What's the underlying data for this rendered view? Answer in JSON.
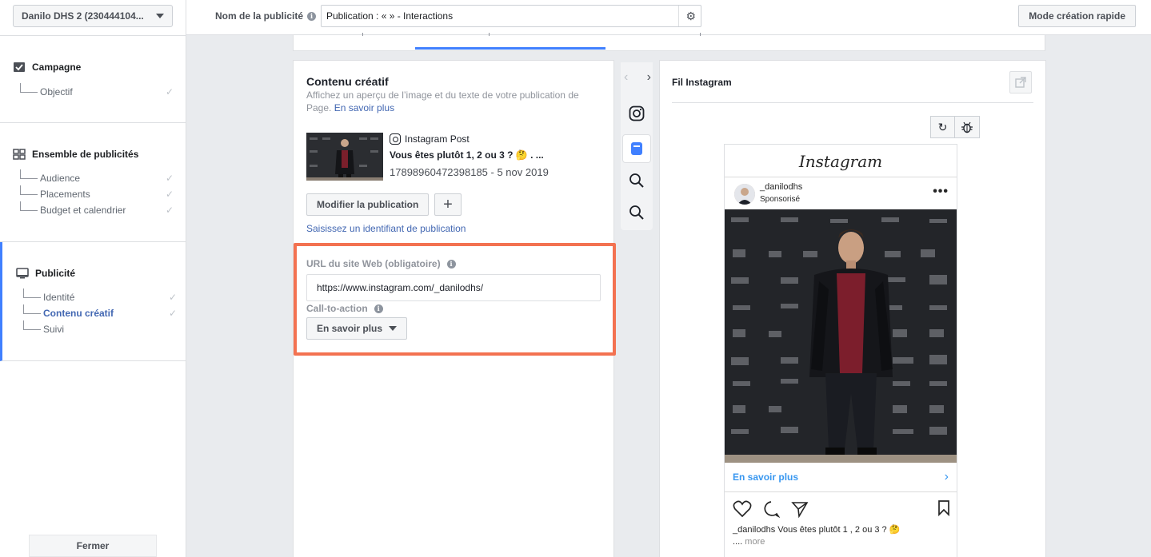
{
  "sidebar": {
    "account": "Danilo DHS 2 (230444104...",
    "campaign": {
      "title": "Campagne",
      "items": [
        {
          "label": "Objectif",
          "done": true
        }
      ]
    },
    "adset": {
      "title": "Ensemble de publicités",
      "items": [
        {
          "label": "Audience",
          "done": true
        },
        {
          "label": "Placements",
          "done": true
        },
        {
          "label": "Budget et calendrier",
          "done": true
        }
      ]
    },
    "ad": {
      "title": "Publicité",
      "items": [
        {
          "label": "Identité",
          "done": true
        },
        {
          "label": "Contenu créatif",
          "done": true,
          "current": true
        },
        {
          "label": "Suivi",
          "done": false
        }
      ]
    },
    "close_label": "Fermer"
  },
  "topbar": {
    "name_label": "Nom de la publicité",
    "name_value": "Publication : «  » - Interactions",
    "quick_mode_label": "Mode création rapide"
  },
  "creative": {
    "title": "Contenu créatif",
    "description": "Affichez un aperçu de l’image et du texte de votre publication de Page.",
    "learn_more": "En savoir plus",
    "post_type": "Instagram Post",
    "post_title": "Vous êtes plutôt 1, 2 ou 3 ? 🤔  . ...",
    "post_meta": "17898960472398185 - 5 nov 2019",
    "modify_label": "Modifier la publication",
    "enter_id_label": "Saisissez un identifiant de publication",
    "url_label": "URL du site Web (obligatoire)",
    "url_value": "https://www.instagram.com/_danilodhs/",
    "cta_label": "Call-to-action",
    "cta_value": "En savoir plus"
  },
  "preview": {
    "title": "Fil Instagram",
    "ig_logo": "Instagram",
    "username": "_danilodhs",
    "sponsored": "Sponsorisé",
    "cta": "En savoir plus",
    "caption_user": "_danilodhs",
    "caption_text": "Vous êtes plutôt 1 , 2 ou 3 ? 🤔",
    "caption_rest": "....",
    "caption_more": "more"
  },
  "colors": {
    "accent": "#4080ff",
    "highlight": "#f37251",
    "link": "#4267b2",
    "ig_blue": "#3897f0"
  },
  "icons": [
    "checkbox-icon",
    "grid-icon",
    "monitor-icon",
    "info-icon",
    "gear-icon",
    "instagram-icon",
    "feed-icon",
    "search-icon",
    "refresh-icon",
    "bug-icon",
    "external-link-icon",
    "heart-icon",
    "comment-icon",
    "send-icon",
    "bookmark-icon",
    "more-icon",
    "chevron-right-icon",
    "chevron-left-icon"
  ]
}
